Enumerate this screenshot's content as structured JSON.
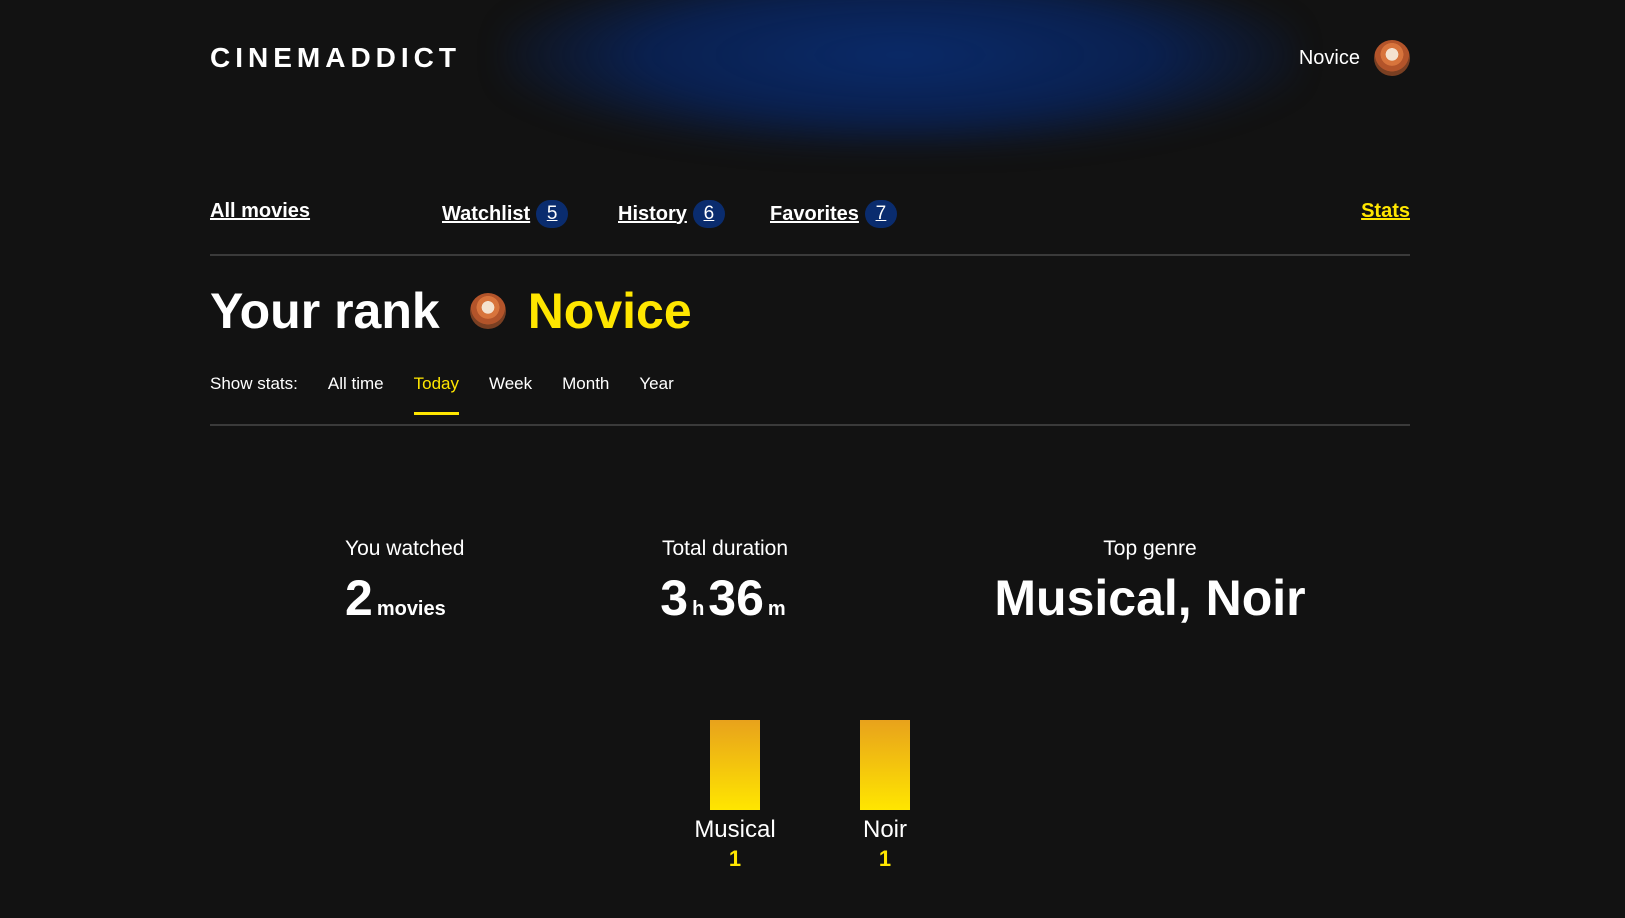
{
  "header": {
    "logo": "CINEMADDICT",
    "profile_rating": "Novice",
    "avatar_icon": "avatar-icon"
  },
  "nav": {
    "all_movies": "All movies",
    "watchlist": {
      "label": "Watchlist",
      "count": "5"
    },
    "history": {
      "label": "History",
      "count": "6"
    },
    "favorites": {
      "label": "Favorites",
      "count": "7"
    },
    "stats": "Stats"
  },
  "rank": {
    "label": "Your rank",
    "name": "Novice"
  },
  "filters": {
    "label": "Show stats:",
    "options": [
      "All time",
      "Today",
      "Week",
      "Month",
      "Year"
    ],
    "selected": "Today"
  },
  "stats": {
    "watched": {
      "label": "You watched",
      "value": "2",
      "unit": "movies"
    },
    "duration": {
      "label": "Total duration",
      "hours": "3",
      "hours_unit": "h",
      "minutes": "36",
      "minutes_unit": "m"
    },
    "genre": {
      "label": "Top genre",
      "value": "Musical, Noir"
    }
  },
  "colors": {
    "accent": "#ffe600",
    "count_badge": "#0a2c6e",
    "background": "#121212"
  },
  "chart_data": {
    "type": "bar",
    "categories": [
      "Musical",
      "Noir"
    ],
    "values": [
      1,
      1
    ],
    "ylim": [
      0,
      1
    ]
  }
}
